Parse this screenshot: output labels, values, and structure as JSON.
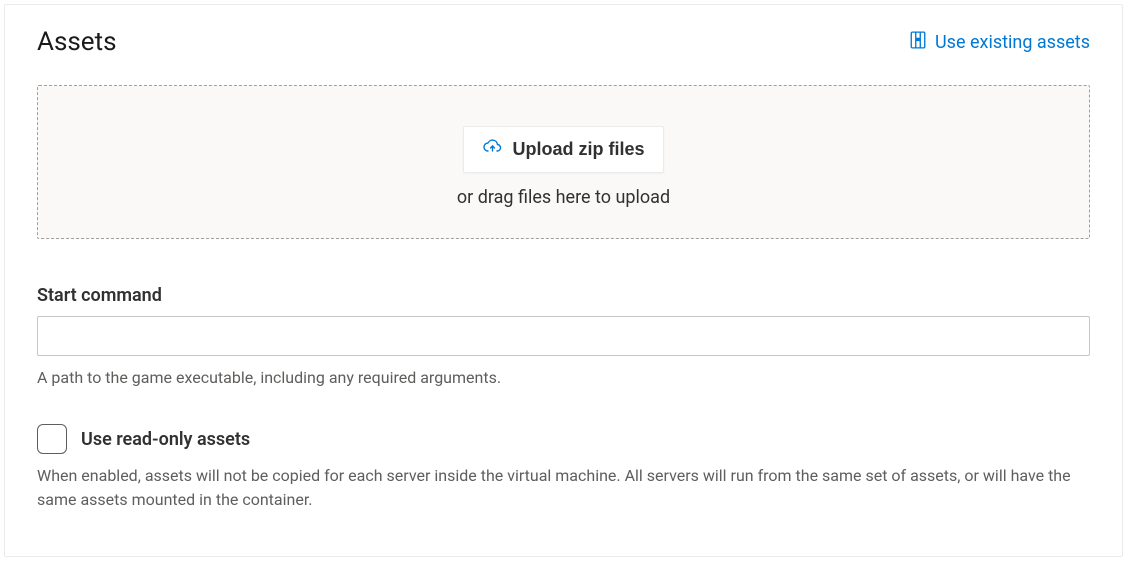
{
  "header": {
    "title": "Assets",
    "use_existing_label": "Use existing assets"
  },
  "dropzone": {
    "upload_button_label": "Upload zip files",
    "drag_hint": "or drag files here to upload"
  },
  "start_command": {
    "label": "Start command",
    "value": "",
    "helper": "A path to the game executable, including any required arguments."
  },
  "readonly_assets": {
    "label": "Use read-only assets",
    "checked": false,
    "helper": "When enabled, assets will not be copied for each server inside the virtual machine. All servers will run from the same set of assets, or will have the same assets mounted in the container."
  }
}
